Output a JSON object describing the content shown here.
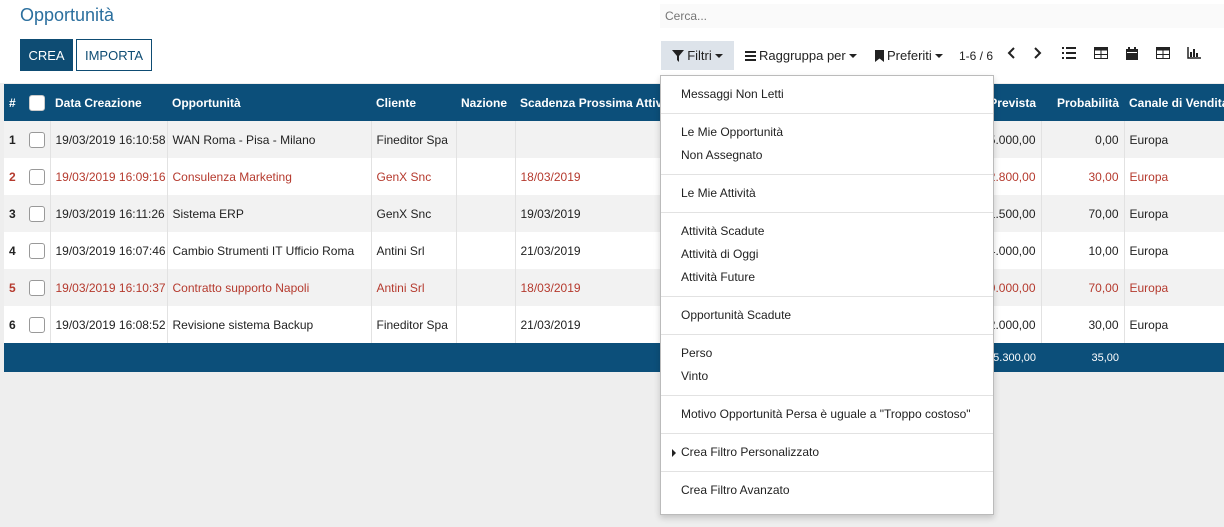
{
  "page": {
    "title": "Opportunità"
  },
  "search": {
    "placeholder": "Cerca..."
  },
  "buttons": {
    "create": "CREA",
    "import": "IMPORTA"
  },
  "toolbar": {
    "filters": "Filtri",
    "group_by": "Raggruppa per",
    "favorites": "Preferiti",
    "pager": "1-6 / 6"
  },
  "table": {
    "headers": [
      "#",
      "",
      "Data Creazione",
      "Opportunità",
      "Cliente",
      "Nazione",
      "Scadenza Prossima Attività",
      "Prevista",
      "Probabilità",
      "Canale di Vendita"
    ],
    "rows": [
      {
        "idx": "1",
        "date": "19/03/2019 16:10:58",
        "opp": "WAN Roma - Pisa - Milano",
        "client": "Fineditor Spa",
        "nation": "",
        "deadline": "",
        "expected": "5.000,00",
        "prob": "0,00",
        "channel": "Europa",
        "red": false
      },
      {
        "idx": "2",
        "date": "19/03/2019 16:09:16",
        "opp": "Consulenza Marketing",
        "client": "GenX Snc",
        "nation": "",
        "deadline": "18/03/2019",
        "expected": "2.800,00",
        "prob": "30,00",
        "channel": "Europa",
        "red": true
      },
      {
        "idx": "3",
        "date": "19/03/2019 16:11:26",
        "opp": "Sistema ERP",
        "client": "GenX Snc",
        "nation": "",
        "deadline": "19/03/2019",
        "expected": "1.500,00",
        "prob": "70,00",
        "channel": "Europa",
        "red": false
      },
      {
        "idx": "4",
        "date": "19/03/2019 16:07:46",
        "opp": "Cambio Strumenti IT Ufficio Roma",
        "client": "Antini Srl",
        "nation": "",
        "deadline": "21/03/2019",
        "expected": "4.000,00",
        "prob": "10,00",
        "channel": "Europa",
        "red": false
      },
      {
        "idx": "5",
        "date": "19/03/2019 16:10:37",
        "opp": "Contratto supporto Napoli",
        "client": "Antini Srl",
        "nation": "",
        "deadline": "18/03/2019",
        "expected": "0.000,00",
        "prob": "70,00",
        "channel": "Europa",
        "red": true
      },
      {
        "idx": "6",
        "date": "19/03/2019 16:08:52",
        "opp": "Revisione sistema Backup",
        "client": "Fineditor Spa",
        "nation": "",
        "deadline": "21/03/2019",
        "expected": "2.000,00",
        "prob": "30,00",
        "channel": "Europa",
        "red": false
      }
    ],
    "totals": {
      "expected": "5.300,00",
      "prob": "35,00"
    }
  },
  "filters_menu": {
    "groups": [
      [
        "Messaggi Non Letti"
      ],
      [
        "Le Mie Opportunità",
        "Non Assegnato"
      ],
      [
        "Le Mie Attività"
      ],
      [
        "Attività Scadute",
        "Attività di Oggi",
        "Attività Future"
      ],
      [
        "Opportunità Scadute"
      ],
      [
        "Perso",
        "Vinto"
      ],
      [
        "Motivo Opportunità Persa è uguale a \"Troppo costoso\""
      ],
      [
        "Crea Filtro Personalizzato"
      ],
      [
        "Crea Filtro Avanzato"
      ]
    ]
  },
  "colors": {
    "brand": "#0c4f7a",
    "title": "#2b6f9e",
    "overdue": "#b53a2e"
  },
  "icons": [
    "filter-icon",
    "list-bars-icon",
    "bookmark-icon",
    "chevron-left-icon",
    "chevron-right-icon",
    "list-view-icon",
    "kanban-view-icon",
    "calendar-view-icon",
    "pivot-view-icon",
    "graph-view-icon"
  ]
}
